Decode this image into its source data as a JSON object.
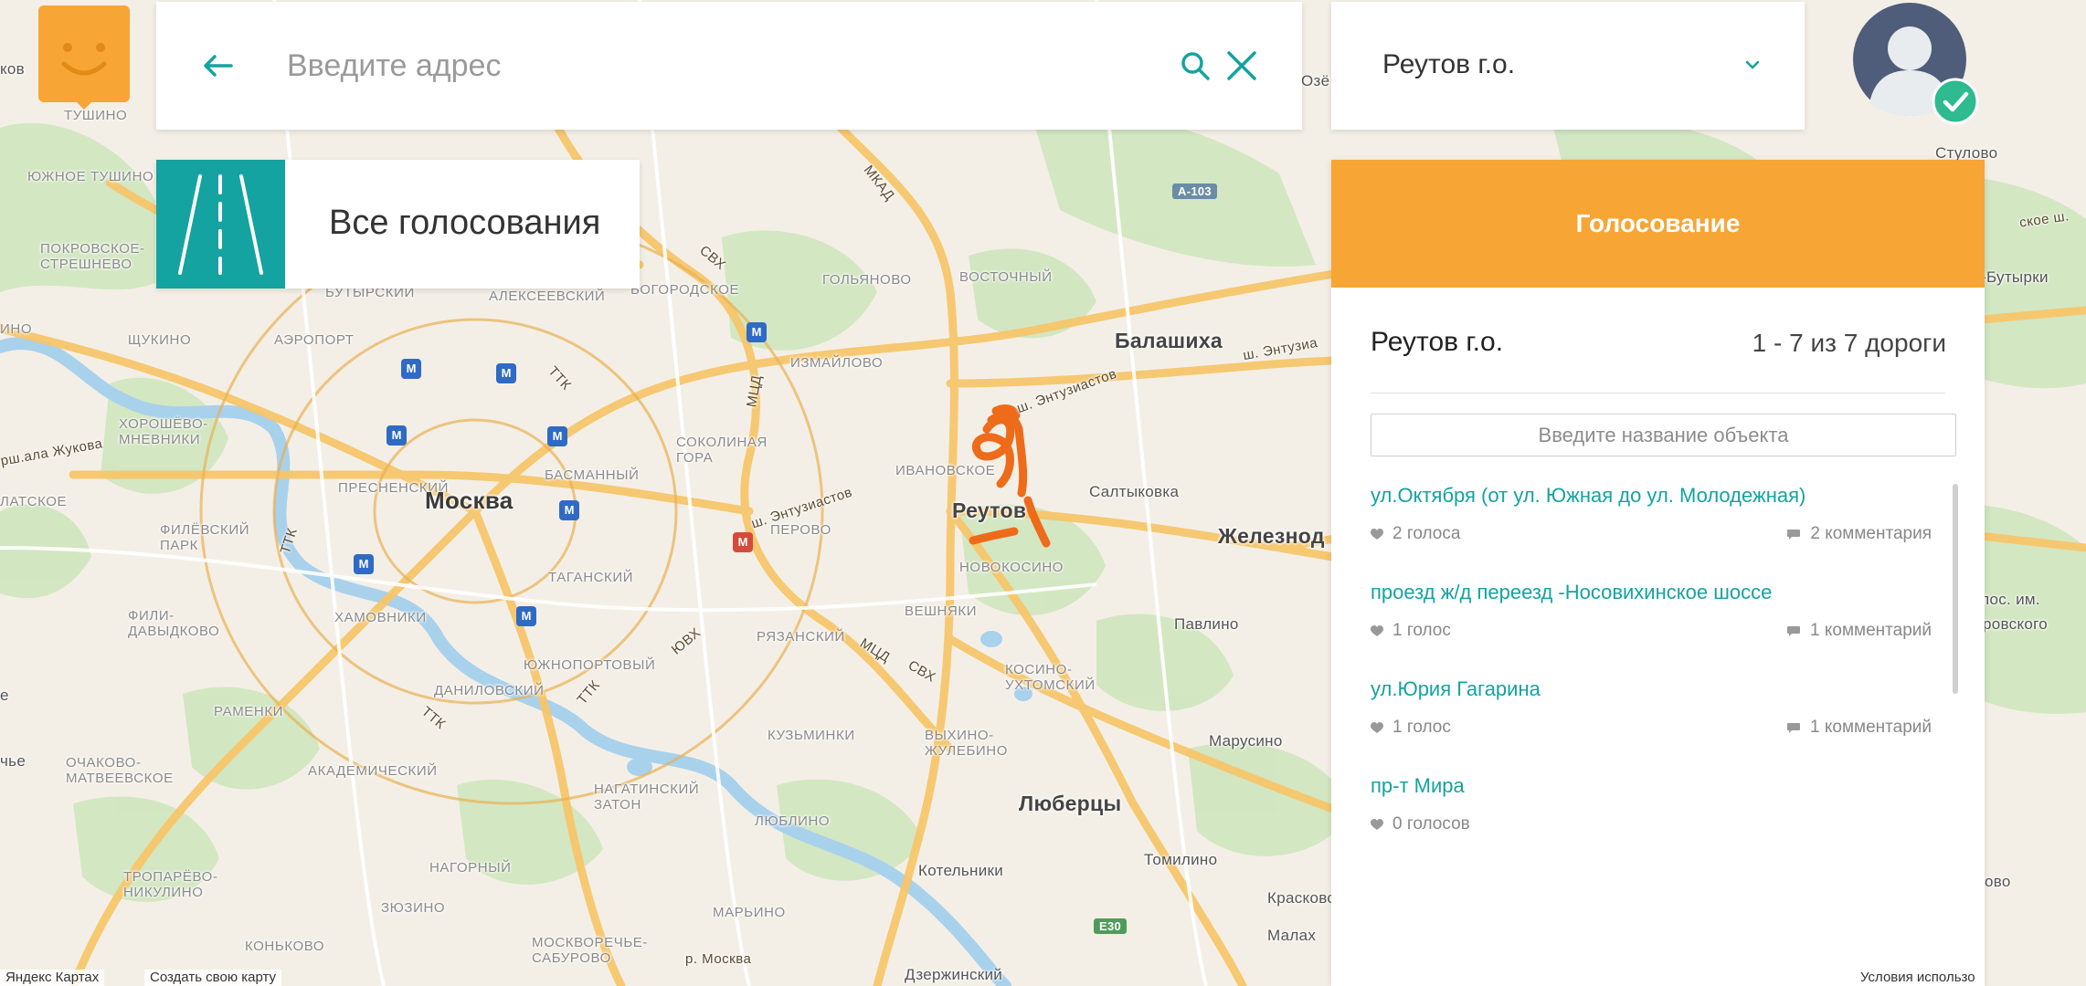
{
  "header": {
    "address_placeholder": "Введите адрес",
    "region": "Реутов г.о."
  },
  "all_votes": {
    "label": "Все голосования"
  },
  "panel": {
    "title": "Голосование",
    "region": "Реутов г.о.",
    "count": "1 - 7 из 7 дороги",
    "search_placeholder": "Введите название объекта",
    "roads": [
      {
        "title": "ул.Октября (от ул. Южная до ул. Молодежная)",
        "votes": "2 голоса",
        "comments": "2 комментария"
      },
      {
        "title": "проезд ж/д переезд -Носовихинское шоссе",
        "votes": "1 голос",
        "comments": "1 комментарий"
      },
      {
        "title": "ул.Юрия Гагарина",
        "votes": "1 голос",
        "comments": "1 комментарий"
      },
      {
        "title": "пр-т Мира",
        "votes": "0 голосов",
        "comments": ""
      }
    ]
  },
  "map": {
    "labels": {
      "tushino": "ТУШИНО",
      "yuzhnoe_tushino": "ЮЖНОЕ ТУШИНО",
      "pokrovskoe": "ПОКРОВСКОЕ-\nСТРЕШНЕВО",
      "butyrsky": "БУТЫРСКИЙ",
      "alekseevsky": "АЛЕКСЕЕВСКИЙ",
      "bogorodskoe": "БОГОРОДСКОЕ",
      "golyanovo": "ГОЛЬЯНОВО",
      "vostochny": "ВОСТОЧНЫЙ",
      "shchukino": "ЩУКИНО",
      "aeroport": "АЭРОПОРТ",
      "izmailovo": "ИЗМАЙЛОВО",
      "balashikha": "Балашиха",
      "horoshevo": "ХОРОШЁВО-\nМНЕВНИКИ",
      "sokolinaya": "СОКОЛИНАЯ\nГОРА",
      "presnensky": "ПРЕСНЕНСКИЙ",
      "basmanny": "БАСМАННЫЙ",
      "ivanovskoe": "ИВАНОВСКОЕ",
      "moskva": "Москва",
      "reutov": "Реутов",
      "saltykovka": "Салтыковка",
      "zheleznodor": "Железнод",
      "latskoe": "ЛАТСКОЕ",
      "filevsky": "ФИЛЁВСКИЙ\nПАРК",
      "perovo": "ПЕРОВО",
      "novokosino": "НОВОКОСИНО",
      "taganskiy": "ТАГАНСКИЙ",
      "fili": "ФИЛИ-\nДАВЫДКОВО",
      "hamovniki": "ХАМОВНИКИ",
      "veshnyaki": "ВЕШНЯКИ",
      "pavlino": "Павлино",
      "ryazansky": "РЯЗАНСКИЙ",
      "yuzhnoport": "ЮЖНОПОРТОВЫЙ",
      "kosino": "КОСИНО-\nУХТОМСКИЙ",
      "danilovsky": "ДАНИЛОВСКИЙ",
      "ramenki": "РАМЕНКИ",
      "kuzminki": "КУЗЬМИНКИ",
      "vykhino": "ВЫХИНО-\nЖУЛЕБИНО",
      "marusino": "Марусино",
      "ochakovo": "ОЧАКОВО-\nМАТВЕЕВСКОЕ",
      "akademichesky": "АКАДЕМИЧЕСКИЙ",
      "nagatinsky": "НАГАТИНСКИЙ\nЗАТОН",
      "lyubertsy": "Люберцы",
      "lyublino": "ЛЮБЛИНО",
      "tropareo": "ТРОПАРЁВО-\nНИКУЛИНО",
      "nagorny": "НАГОРНЫЙ",
      "tomilino": "Томилино",
      "kotelniki": "Котельники",
      "zyuzino": "ЗЮЗИНО",
      "maryino": "МАРЬИНО",
      "kraskovo": "Красково",
      "konkovo": "КОНЬКОВО",
      "moskvorechye": "МОСКВОРЕЧЬЕ-\nСАБУРОВО",
      "moskva_river": "р. Москва",
      "dzerzhinsky": "Дзержинский",
      "malakh": "Малах",
      "stulovo": "Стулово",
      "butyrki": "-Бутырки",
      "pos_im": "пос. им.",
      "vorovskogo": "ровского",
      "ovo": "ово",
      "chye": "чье",
      "kov": "ков",
      "ozo": "Озё",
      "e": "е",
      "ino": "ино",
      "entuz1": "ш. Энтузиастов",
      "entuz2": "ш. Энтузиастов",
      "entuz3": "ш. Энтузиа",
      "zhukova": "рш.ала Жукова",
      "mkad": "МКАД",
      "svh1": "СВХ",
      "svh2": "СВХ",
      "mcd1": "МЦД",
      "mcd2": "МЦД",
      "ttk1": "ТТК",
      "ttk2": "ТТК",
      "ttk3": "ТТК",
      "ttk4": "ТТК",
      "yuvh": "ЮВХ",
      "sh": "ское ш.",
      "a103": "A-103",
      "e30": "E30"
    }
  },
  "footer": {
    "yandex": "Яндекс Картах",
    "create": "Создать свою карту",
    "terms": "Условия использо"
  }
}
